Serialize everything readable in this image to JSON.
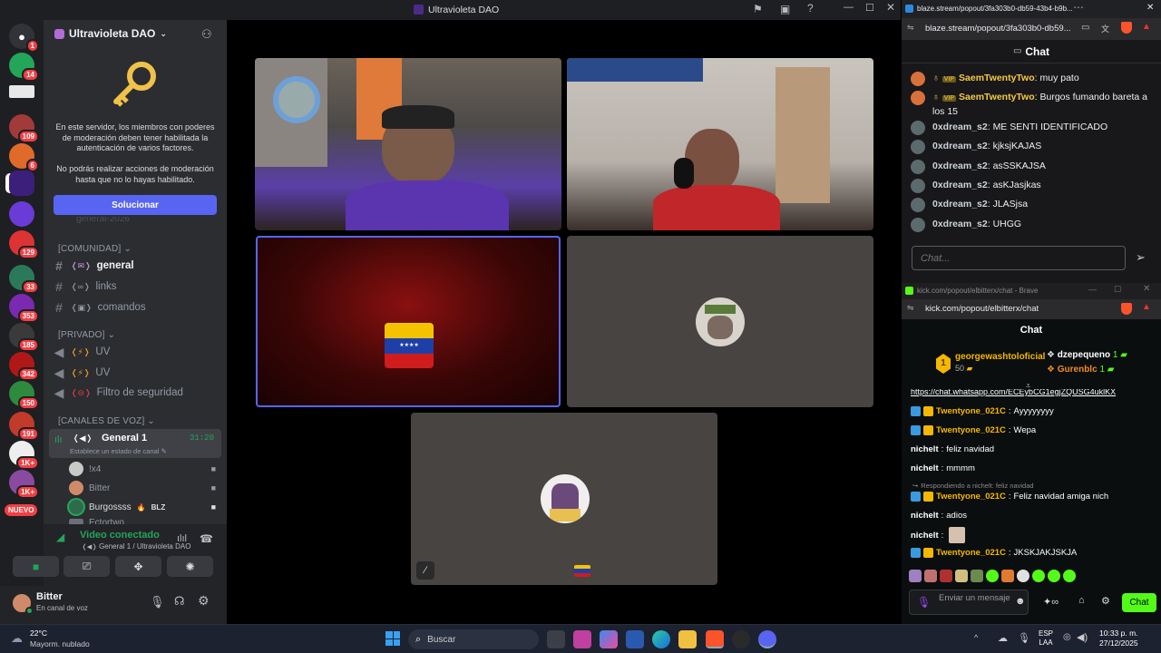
{
  "window": {
    "title": "Ultravioleta DAO"
  },
  "server": {
    "name": "Ultravioleta DAO",
    "notice_1": "En este servidor, los miembros con poderes de moderación deben tener habilitada la autenticación de varios factores.",
    "notice_2": "No podrás realizar acciones de moderación hasta que no lo hayas habilitado.",
    "fix_button": "Solucionar",
    "faded_channel": "general-2026"
  },
  "server_badges": [
    "1",
    "14",
    "109",
    "6",
    "129",
    "33",
    "353",
    "185",
    "342",
    "150",
    "191",
    "1K+",
    "1K+"
  ],
  "new_label": "NUEVO",
  "categories": {
    "community": "[COMUNIDAD]",
    "private": "[PRIVADO]",
    "voice": "[CANALES DE VOZ]"
  },
  "channels": {
    "general": "general",
    "links": "links",
    "commands": "comandos",
    "uv1": "UV",
    "uv2": "UV",
    "filter": "Filtro de seguridad"
  },
  "voice_channel": {
    "name": "General 1",
    "time": "31:20",
    "status_hint": "Establece un estado de canal"
  },
  "voice_users": [
    {
      "name": "!x4"
    },
    {
      "name": "Bitter"
    },
    {
      "name": "Burgossss",
      "tag": "BLZ"
    },
    {
      "name": "Ectortwo"
    }
  ],
  "connection": {
    "status": "Video conectado",
    "location": "General 1 / Ultravioleta DAO"
  },
  "user": {
    "name": "Bitter",
    "status": "En canal de voz"
  },
  "blaze": {
    "tab_title": "blaze.stream/popout/3fa303b0-db59-43b4-b9b...",
    "url": "blaze.stream/popout/3fa303b0-db59...",
    "header": "Chat",
    "messages": [
      {
        "user": "SaemTwentyTwo",
        "vip": "VIP",
        "text": "muy pato"
      },
      {
        "user": "SaemTwentyTwo",
        "vip": "VIP",
        "text": "Burgos fumando bareta a los 15"
      },
      {
        "user": "0xdream_s2",
        "text": "ME SENTI IDENTIFICADO"
      },
      {
        "user": "0xdream_s2",
        "text": "kjksjKAJAS"
      },
      {
        "user": "0xdream_s2",
        "text": "asSSKAJSA"
      },
      {
        "user": "0xdream_s2",
        "text": "asKJasjkas"
      },
      {
        "user": "0xdream_s2",
        "text": "JLASjsa"
      },
      {
        "user": "0xdream_s2",
        "text": "UHGG"
      }
    ],
    "input_placeholder": "Chat...",
    "colors": {
      "vip_name": "#f6c945"
    }
  },
  "kick": {
    "tab_title": "kick.com/popout/elbitterx/chat - Brave",
    "url": "kick.com/popout/elbitterx/chat",
    "header": "Chat",
    "top_gifter": {
      "rank": "1",
      "name": "georgewashtoloficial",
      "amount": "50"
    },
    "gifters": [
      {
        "name": "dzepequeno",
        "amount": "1"
      },
      {
        "name": "Gurenblc",
        "amount": "1"
      }
    ],
    "link": "https://chat.whatsapp.com/ECEybCG1egjZQUSG4uklKX",
    "messages": [
      {
        "user": "Twentyone_021C",
        "text": "Ayyyyyyyy",
        "badges": true
      },
      {
        "user": "Twentyone_021C",
        "text": "Wepa",
        "badges": true
      },
      {
        "user": "nichelt",
        "text": "feliz navidad"
      },
      {
        "user": "nichelt",
        "text": "mmmm"
      },
      {
        "reply": "Respondiendo a nichelt: feliz navidad",
        "user": "Twentyone_021C",
        "text": "Feliz navidad amiga nich",
        "badges": true
      },
      {
        "user": "nichelt",
        "text": "adios"
      },
      {
        "user": "nichelt",
        "text": "",
        "image": true
      },
      {
        "user": "Twentyone_021C",
        "text": "JKSKJAKJSKJA",
        "badges": true
      }
    ],
    "input_placeholder": "Enviar un mensaje",
    "send_label": "Chat",
    "colors": {
      "accent": "#53fc18",
      "twentyone": "#f5b800",
      "nichelt": "#ffffff"
    }
  },
  "taskbar": {
    "weather_temp": "22°C",
    "weather_desc": "Mayorm. nublado",
    "search_placeholder": "Buscar",
    "lang": "ESP",
    "region": "LAA",
    "time": "10:33 p. m.",
    "date": "27/12/2025"
  }
}
